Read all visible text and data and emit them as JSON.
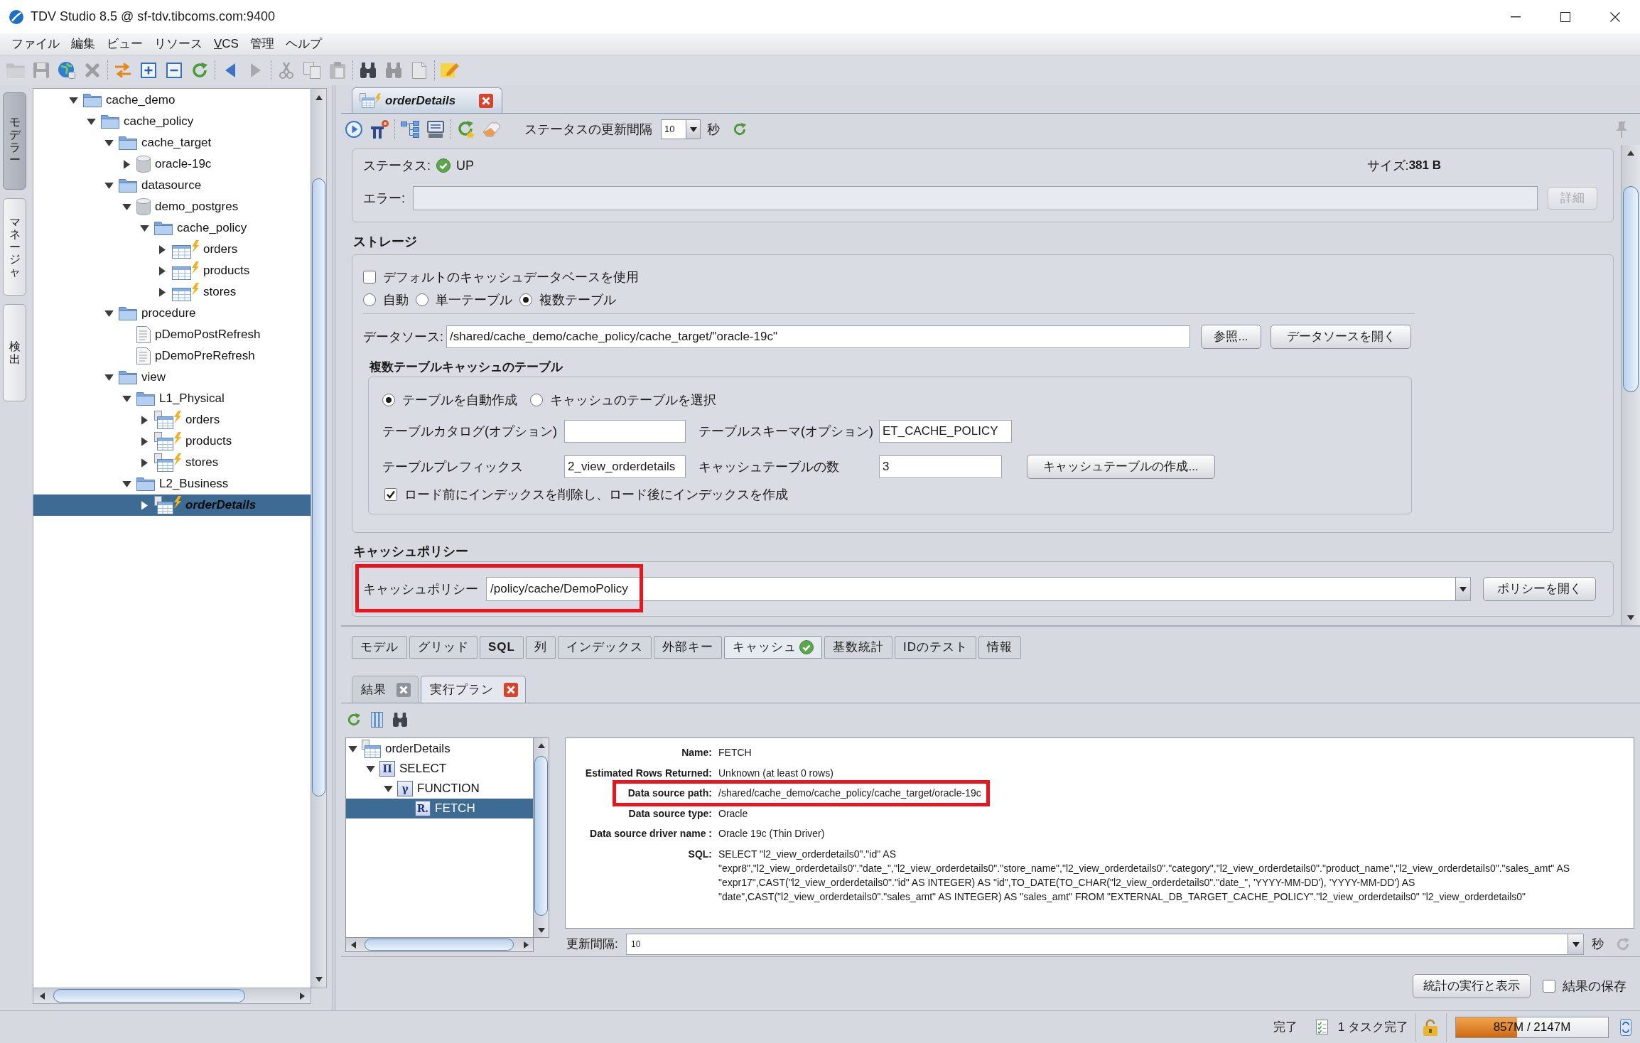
{
  "window": {
    "title": "TDV Studio 8.5 @ sf-tdv.tibcoms.com:9400"
  },
  "menu": [
    {
      "label": "ファイル",
      "mnemonic": false
    },
    {
      "label": "編集",
      "mnemonic": false
    },
    {
      "label": "ビュー",
      "mnemonic": false
    },
    {
      "label": "リソース",
      "mnemonic": false
    },
    {
      "label": "VCS",
      "mnemonic": true
    },
    {
      "label": "管理",
      "mnemonic": false
    },
    {
      "label": "ヘルプ",
      "mnemonic": false
    }
  ],
  "toolbar": [
    {
      "kind": "open",
      "disabled": true
    },
    {
      "kind": "save",
      "disabled": true
    },
    {
      "kind": "publish",
      "disabled": false
    },
    {
      "kind": "delete",
      "disabled": true
    },
    {
      "kind": "separator"
    },
    {
      "kind": "swap",
      "disabled": false
    },
    {
      "kind": "expand",
      "disabled": false
    },
    {
      "kind": "collapse",
      "disabled": false
    },
    {
      "kind": "refresh",
      "disabled": false
    },
    {
      "kind": "separator"
    },
    {
      "kind": "back",
      "disabled": false
    },
    {
      "kind": "forward",
      "disabled": true
    },
    {
      "kind": "separator"
    },
    {
      "kind": "cut",
      "disabled": true
    },
    {
      "kind": "copy",
      "disabled": true
    },
    {
      "kind": "paste",
      "disabled": true
    },
    {
      "kind": "separator"
    },
    {
      "kind": "find",
      "disabled": false
    },
    {
      "kind": "findnext",
      "disabled": true
    },
    {
      "kind": "document",
      "disabled": true
    },
    {
      "kind": "separator"
    },
    {
      "kind": "note",
      "disabled": false
    }
  ],
  "side_tabs": [
    {
      "label": "モデラー",
      "selected": true
    },
    {
      "label": "マネージャ",
      "selected": false
    },
    {
      "label": "検出",
      "selected": false
    }
  ],
  "resource_tree": [
    {
      "label": "cache_demo",
      "kind": "folder",
      "expanded": true,
      "selected": false,
      "children": [
        {
          "label": "cache_policy",
          "kind": "folder",
          "expanded": true,
          "selected": false,
          "children": [
            {
              "label": "cache_target",
              "kind": "folder",
              "expanded": true,
              "selected": false,
              "children": [
                {
                  "label": "oracle-19c",
                  "kind": "datasource",
                  "expanded": false,
                  "selected": false
                }
              ]
            },
            {
              "label": "datasource",
              "kind": "folder",
              "expanded": true,
              "selected": false,
              "children": [
                {
                  "label": "demo_postgres",
                  "kind": "datasource",
                  "expanded": true,
                  "selected": false,
                  "children": [
                    {
                      "label": "cache_policy",
                      "kind": "folder",
                      "expanded": true,
                      "selected": false,
                      "children": [
                        {
                          "label": "orders",
                          "kind": "table",
                          "cached": true,
                          "expanded": false,
                          "selected": false
                        },
                        {
                          "label": "products",
                          "kind": "table",
                          "cached": true,
                          "expanded": false,
                          "selected": false
                        },
                        {
                          "label": "stores",
                          "kind": "table",
                          "cached": true,
                          "expanded": false,
                          "selected": false
                        }
                      ]
                    }
                  ]
                }
              ]
            },
            {
              "label": "procedure",
              "kind": "folder",
              "expanded": true,
              "selected": false,
              "children": [
                {
                  "label": "pDemoPostRefresh",
                  "kind": "procedure",
                  "selected": false
                },
                {
                  "label": "pDemoPreRefresh",
                  "kind": "procedure",
                  "selected": false
                }
              ]
            },
            {
              "label": "view",
              "kind": "folder",
              "expanded": true,
              "selected": false,
              "children": [
                {
                  "label": "L1_Physical",
                  "kind": "folder",
                  "expanded": true,
                  "selected": false,
                  "children": [
                    {
                      "label": "orders",
                      "kind": "view",
                      "cached": true,
                      "expanded": false,
                      "selected": false
                    },
                    {
                      "label": "products",
                      "kind": "view",
                      "cached": true,
                      "expanded": false,
                      "selected": false
                    },
                    {
                      "label": "stores",
                      "kind": "view",
                      "cached": true,
                      "expanded": false,
                      "selected": false
                    }
                  ]
                },
                {
                  "label": "L2_Business",
                  "kind": "folder",
                  "expanded": true,
                  "selected": false,
                  "children": [
                    {
                      "label": "orderDetails",
                      "kind": "view",
                      "cached": true,
                      "expanded": false,
                      "selected": true
                    }
                  ]
                }
              ]
            }
          ]
        }
      ]
    }
  ],
  "editor": {
    "tabs": [
      {
        "label": "orderDetails",
        "selected": true
      }
    ],
    "toolbar": [
      {
        "kind": "run",
        "disabled": false
      },
      {
        "kind": "lineage",
        "disabled": false
      },
      {
        "kind": "separator"
      },
      {
        "kind": "hierarchy",
        "disabled": false
      },
      {
        "kind": "monitor",
        "disabled": false
      },
      {
        "kind": "separator"
      },
      {
        "kind": "refreshstar",
        "disabled": false
      },
      {
        "kind": "eraser",
        "disabled": false
      }
    ],
    "refresh_interval": {
      "label": "ステータスの更新間隔",
      "value": "10",
      "unit": "秒"
    },
    "toolbar_right": [
      {
        "kind": "pin",
        "disabled": true
      }
    ],
    "status": {
      "label": "ステータス:",
      "value": "UP",
      "size_label": "サイズ:",
      "size": "381 B",
      "error_label": "エラー:",
      "details_button": {
        "label": "詳細",
        "disabled": true
      }
    },
    "storage": {
      "title": "ストレージ",
      "use_default": {
        "label": "デフォルトのキャッシュデータベースを使用",
        "checked": false
      },
      "modes": [
        {
          "label": "自動",
          "selected": false
        },
        {
          "label": "単一テーブル",
          "selected": false
        },
        {
          "label": "複数テーブル",
          "selected": true
        }
      ],
      "datasource": {
        "label": "データソース:",
        "value": "/shared/cache_demo/cache_policy/cache_target/\"oracle-19c\""
      },
      "buttons": [
        {
          "label": "参照..."
        },
        {
          "label": "データソースを開く"
        }
      ],
      "tables": {
        "title": "複数テーブルキャッシュのテーブル",
        "options": [
          {
            "label": "テーブルを自動作成",
            "selected": true
          },
          {
            "label": "キャッシュのテーブルを選択",
            "selected": false
          }
        ],
        "fields": [
          {
            "label": "テーブルカタログ(オプション)"
          },
          {
            "label": "テーブルスキーマ(オプション)",
            "value": "ET_CACHE_POLICY"
          },
          {
            "label": "テーブルプレフィックス",
            "value": "2_view_orderdetails"
          },
          {
            "label": "キャッシュテーブルの数",
            "value": "3"
          }
        ],
        "create_button": "キャッシュテーブルの作成...",
        "drop_indexes": {
          "label": "ロード前にインデックスを削除し、ロード後にインデックスを作成",
          "checked": true
        }
      }
    },
    "cache_policy": {
      "title": "キャッシュポリシー",
      "label": "キャッシュポリシー",
      "value": "/policy/cache/DemoPolicy",
      "highlighted": true,
      "button": "ポリシーを開く"
    },
    "view_tabs": [
      {
        "label": "モデル",
        "selected": false,
        "bold": false,
        "valid": false
      },
      {
        "label": "グリッド",
        "selected": false,
        "bold": false,
        "valid": false
      },
      {
        "label": "SQL",
        "selected": false,
        "bold": true,
        "valid": false
      },
      {
        "label": "列",
        "selected": false,
        "bold": false,
        "valid": false
      },
      {
        "label": "インデックス",
        "selected": false,
        "bold": false,
        "valid": false
      },
      {
        "label": "外部キー",
        "selected": false,
        "bold": false,
        "valid": false
      },
      {
        "label": "キャッシュ",
        "selected": true,
        "bold": false,
        "valid": true
      },
      {
        "label": "基数統計",
        "selected": false,
        "bold": false,
        "valid": false
      },
      {
        "label": "IDのテスト",
        "selected": false,
        "bold": false,
        "valid": false
      },
      {
        "label": "情報",
        "selected": false,
        "bold": false,
        "valid": false
      }
    ],
    "result_tabs": [
      {
        "label": "結果",
        "selected": false
      },
      {
        "label": "実行プラン",
        "selected": true
      }
    ],
    "plan_tree": [
      {
        "label": "orderDetails",
        "kind": "view",
        "cached": false,
        "expanded": true,
        "selected": false,
        "children": [
          {
            "label": "SELECT",
            "kind": "operator",
            "glyph": "Π",
            "expanded": true,
            "selected": false,
            "children": [
              {
                "label": "FUNCTION",
                "kind": "operator",
                "glyph": "γ",
                "expanded": true,
                "selected": false,
                "children": [
                  {
                    "label": "FETCH",
                    "kind": "operator",
                    "glyph": "R.",
                    "selected": true
                  }
                ]
              }
            ]
          }
        ]
      }
    ],
    "plan_details": [
      {
        "label": "Name:",
        "value": "FETCH",
        "highlighted": false
      },
      {
        "label": "Estimated Rows Returned:",
        "value": "Unknown (at least 0 rows)",
        "highlighted": false
      },
      {
        "label": "Data source path:",
        "value": "/shared/cache_demo/cache_policy/cache_target/oracle-19c",
        "highlighted": true
      },
      {
        "label": "Data source type:",
        "value": "Oracle",
        "highlighted": false
      },
      {
        "label": "Data source driver name :",
        "value": "Oracle 19c (Thin Driver)",
        "highlighted": false
      },
      {
        "label": "SQL:",
        "value": "SELECT \"l2_view_orderdetails0\".\"id\" AS\n\"expr8\",\"l2_view_orderdetails0\".\"date_\",\"l2_view_orderdetails0\".\"store_name\",\"l2_view_orderdetails0\".\"category\",\"l2_view_orderdetails0\".\"product_name\",\"l2_view_orderdetails0\".\"sales_amt\" AS\n\"expr17\",CAST(\"l2_view_orderdetails0\".\"id\" AS INTEGER) AS \"id\",TO_DATE(TO_CHAR(\"l2_view_orderdetails0\".\"date_\", 'YYYY-MM-DD'), 'YYYY-MM-DD') AS\n\"date\",CAST(\"l2_view_orderdetails0\".\"sales_amt\" AS INTEGER) AS \"sales_amt\" FROM \"EXTERNAL_DB_TARGET_CACHE_POLICY\".\"l2_view_orderdetails0\" \"l2_view_orderdetails0\"",
        "highlighted": false
      }
    ],
    "plan_refresh": {
      "label": "更新間隔:",
      "value": "10",
      "unit": "秒",
      "refresh_disabled": true
    },
    "run_button": "統計の実行と表示",
    "save_results": {
      "label": "結果の保存",
      "checked": false
    }
  },
  "status_bar": {
    "message": "完了",
    "tasks": "1 タスク完了",
    "memory": {
      "text": "857M / 2147M",
      "level": 0.4
    }
  }
}
